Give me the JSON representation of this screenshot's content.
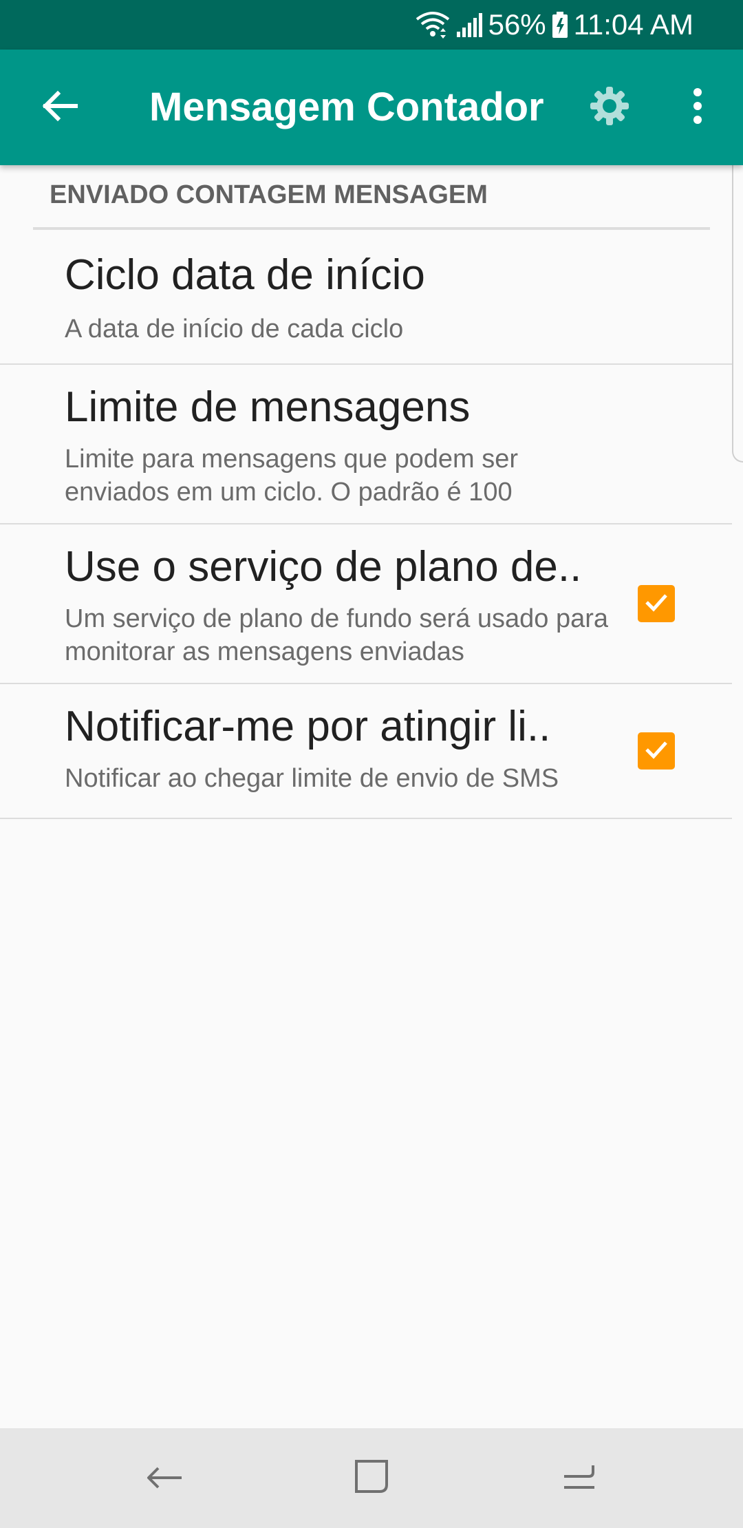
{
  "status_bar": {
    "battery": "56%",
    "time": "11:04 AM"
  },
  "app_bar": {
    "title": "Mensagem Contador",
    "icons": [
      "back-arrow-icon",
      "gear-icon",
      "more-vert-icon"
    ]
  },
  "section": {
    "header": "ENVIADO CONTAGEM MENSAGEM"
  },
  "preferences": [
    {
      "title": "Ciclo data de início",
      "summary": "A data de início de cada ciclo"
    },
    {
      "title": "Limite de mensagens",
      "summary": "Limite para mensagens que podem ser enviados em um ciclo. O padrão é 100"
    },
    {
      "title": "Use o serviço de plano de..",
      "summary": "Um serviço de plano de fundo será usado para monitorar as mensagens enviadas",
      "checked": true
    },
    {
      "title": "Notificar-me por atingir li..",
      "summary": "Notificar ao chegar limite de envio de SMS",
      "checked": true
    }
  ],
  "colors": {
    "status_bar": "#00695c",
    "app_bar": "#009688",
    "checkbox_accent": "#ff9800",
    "nav_bar": "#e6e6e6"
  },
  "nav_bar": {
    "icons": [
      "nav-back-icon",
      "nav-home-icon",
      "nav-recents-icon"
    ]
  }
}
